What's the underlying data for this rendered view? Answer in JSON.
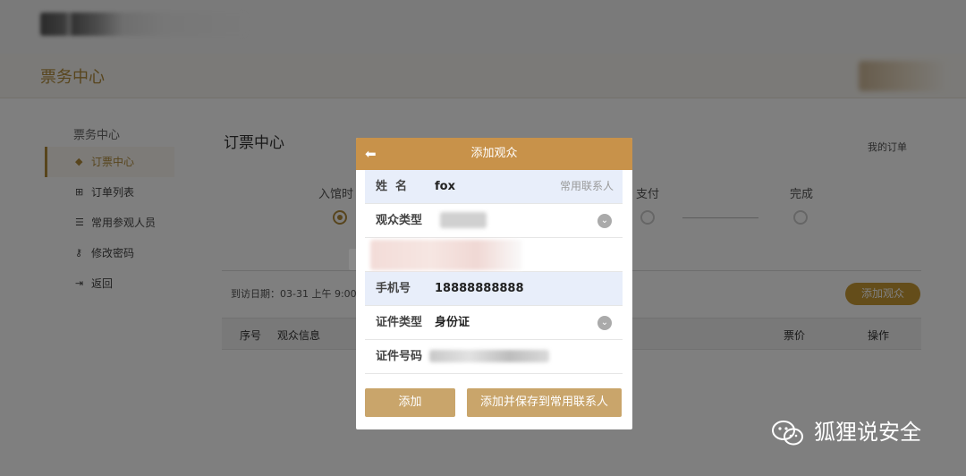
{
  "header": {
    "title": "票务中心"
  },
  "sidebar": {
    "heading": "票务中心",
    "items": [
      {
        "label": "订票中心",
        "icon": "tag-icon"
      },
      {
        "label": "订单列表",
        "icon": "cart-icon"
      },
      {
        "label": "常用参观人员",
        "icon": "list-icon"
      },
      {
        "label": "修改密码",
        "icon": "key-icon"
      },
      {
        "label": "返回",
        "icon": "exit-icon"
      }
    ]
  },
  "main": {
    "title": "订票中心",
    "my_orders": "我的订单",
    "steps": [
      "入馆时",
      "支付",
      "完成"
    ],
    "visit_date": "到访日期：03-31 上午 9:00-1",
    "add_audience": "添加观众",
    "table_headers": [
      "序号",
      "观众信息",
      "票价",
      "操作"
    ]
  },
  "modal": {
    "title": "添加观众",
    "fields": {
      "name": {
        "label": "姓  名",
        "value": "fox",
        "link": "常用联系人"
      },
      "audience_type": {
        "label": "观众类型"
      },
      "phone": {
        "label": "手机号",
        "value": "18888888888"
      },
      "id_type": {
        "label": "证件类型",
        "value": "身份证"
      },
      "id_number": {
        "label": "证件号码"
      }
    },
    "buttons": {
      "add": "添加",
      "add_save": "添加并保存到常用联系人"
    }
  },
  "watermark": {
    "text": "狐狸说安全"
  },
  "colors": {
    "accent": "#c8924a",
    "button": "#c9a56b",
    "highlight_row": "#e8eefa"
  }
}
